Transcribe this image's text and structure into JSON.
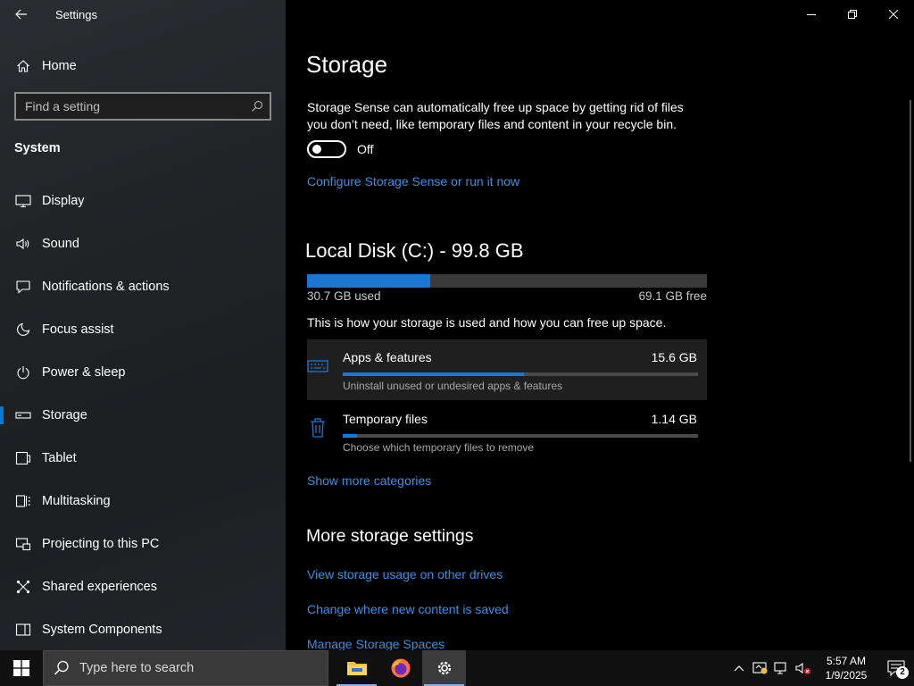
{
  "window": {
    "title": "Settings"
  },
  "sidebar": {
    "home_label": "Home",
    "search_placeholder": "Find a setting",
    "section": "System",
    "items": [
      {
        "label": "Display",
        "icon": "display-icon"
      },
      {
        "label": "Sound",
        "icon": "speaker-icon"
      },
      {
        "label": "Notifications & actions",
        "icon": "notification-icon"
      },
      {
        "label": "Focus assist",
        "icon": "moon-icon"
      },
      {
        "label": "Power & sleep",
        "icon": "power-icon"
      },
      {
        "label": "Storage",
        "icon": "storage-icon",
        "active": true
      },
      {
        "label": "Tablet",
        "icon": "tablet-icon"
      },
      {
        "label": "Multitasking",
        "icon": "multitasking-icon"
      },
      {
        "label": "Projecting to this PC",
        "icon": "projecting-icon"
      },
      {
        "label": "Shared experiences",
        "icon": "shared-icon"
      },
      {
        "label": "System Components",
        "icon": "components-icon"
      }
    ]
  },
  "main": {
    "title": "Storage",
    "storage_sense_desc": "Storage Sense can automatically free up space by getting rid of files you don’t need, like temporary files and content in your recycle bin.",
    "toggle_state": "Off",
    "configure_link": "Configure Storage Sense or run it now",
    "disk": {
      "title": "Local Disk (C:) - 99.8 GB",
      "used_fraction": 0.308,
      "used_label": "30.7 GB used",
      "free_label": "69.1 GB free"
    },
    "usage_desc": "This is how your storage is used and how you can free up space.",
    "categories": [
      {
        "name": "Apps & features",
        "size": "15.6 GB",
        "sub": "Uninstall unused or undesired apps & features",
        "fraction": 0.51,
        "icon": "keyboard-icon"
      },
      {
        "name": "Temporary files",
        "size": "1.14 GB",
        "sub": "Choose which temporary files to remove",
        "fraction": 0.04,
        "icon": "trash-icon"
      }
    ],
    "show_more": "Show more categories",
    "more_heading": "More storage settings",
    "more_links": [
      "View storage usage on other drives",
      "Change where new content is saved",
      "Manage Storage Spaces"
    ]
  },
  "taskbar": {
    "search_placeholder": "Type here to search",
    "apps": [
      "file-explorer-icon",
      "firefox-icon",
      "settings-icon"
    ],
    "time": "5:57 AM",
    "date": "1/9/2025",
    "notification_count": "2"
  },
  "colors": {
    "accent": "#0078d7",
    "link": "#3a8ee6",
    "bar_fill": "#1d76d2"
  }
}
